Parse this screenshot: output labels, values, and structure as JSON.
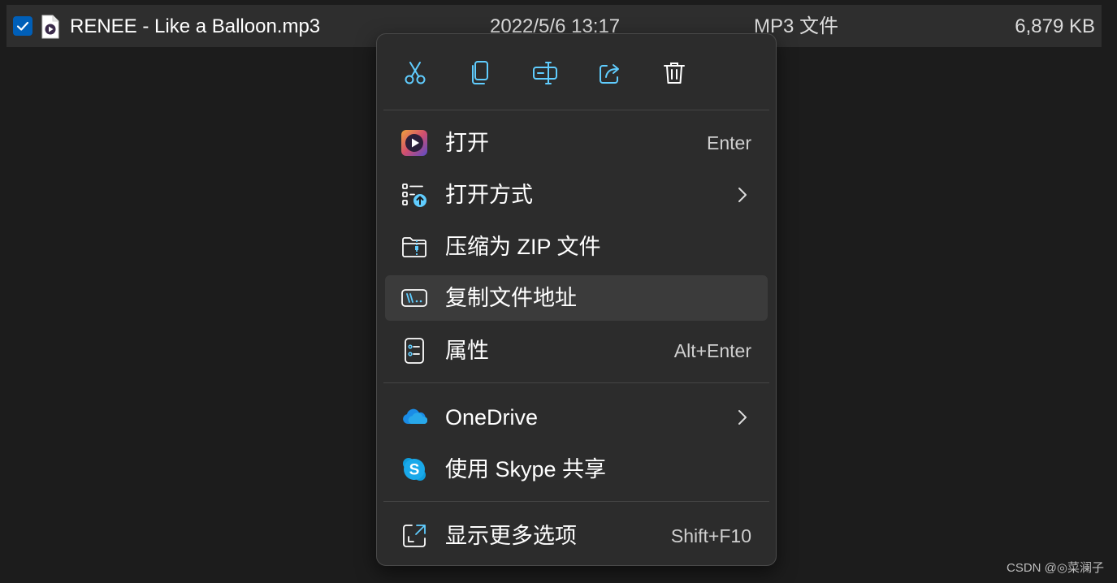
{
  "file": {
    "name": "RENEE - Like a Balloon.mp3",
    "date": "2022/5/6 13:17",
    "type": "MP3 文件",
    "size": "6,879 KB",
    "checked": true,
    "icon": "mp3-file-icon"
  },
  "toolbar": {
    "buttons": [
      {
        "name": "cut",
        "icon": "scissors-icon"
      },
      {
        "name": "copy",
        "icon": "copy-icon"
      },
      {
        "name": "rename",
        "icon": "rename-icon"
      },
      {
        "name": "share",
        "icon": "share-icon"
      },
      {
        "name": "delete",
        "icon": "trash-icon"
      }
    ]
  },
  "menu": {
    "open": {
      "label": "打开",
      "shortcut": "Enter",
      "icon": "media-player-icon"
    },
    "open_with": {
      "label": "打开方式",
      "icon": "open-with-icon",
      "has_submenu": true
    },
    "compress_zip": {
      "label": "压缩为 ZIP 文件",
      "icon": "zip-folder-icon"
    },
    "copy_path": {
      "label": "复制文件地址",
      "icon": "copy-path-icon",
      "highlighted": true
    },
    "properties": {
      "label": "属性",
      "shortcut": "Alt+Enter",
      "icon": "properties-icon"
    },
    "onedrive": {
      "label": "OneDrive",
      "icon": "onedrive-icon",
      "has_submenu": true
    },
    "skype_share": {
      "label": "使用 Skype 共享",
      "icon": "skype-icon"
    },
    "more_options": {
      "label": "显示更多选项",
      "shortcut": "Shift+F10",
      "icon": "expand-icon"
    }
  },
  "watermark": "CSDN @◎菜澜子",
  "colors": {
    "background": "#1c1c1c",
    "row_selected": "#2e2e2e",
    "menu_bg": "#2c2c2c",
    "accent": "#60cdff",
    "checkbox": "#005fb8"
  }
}
